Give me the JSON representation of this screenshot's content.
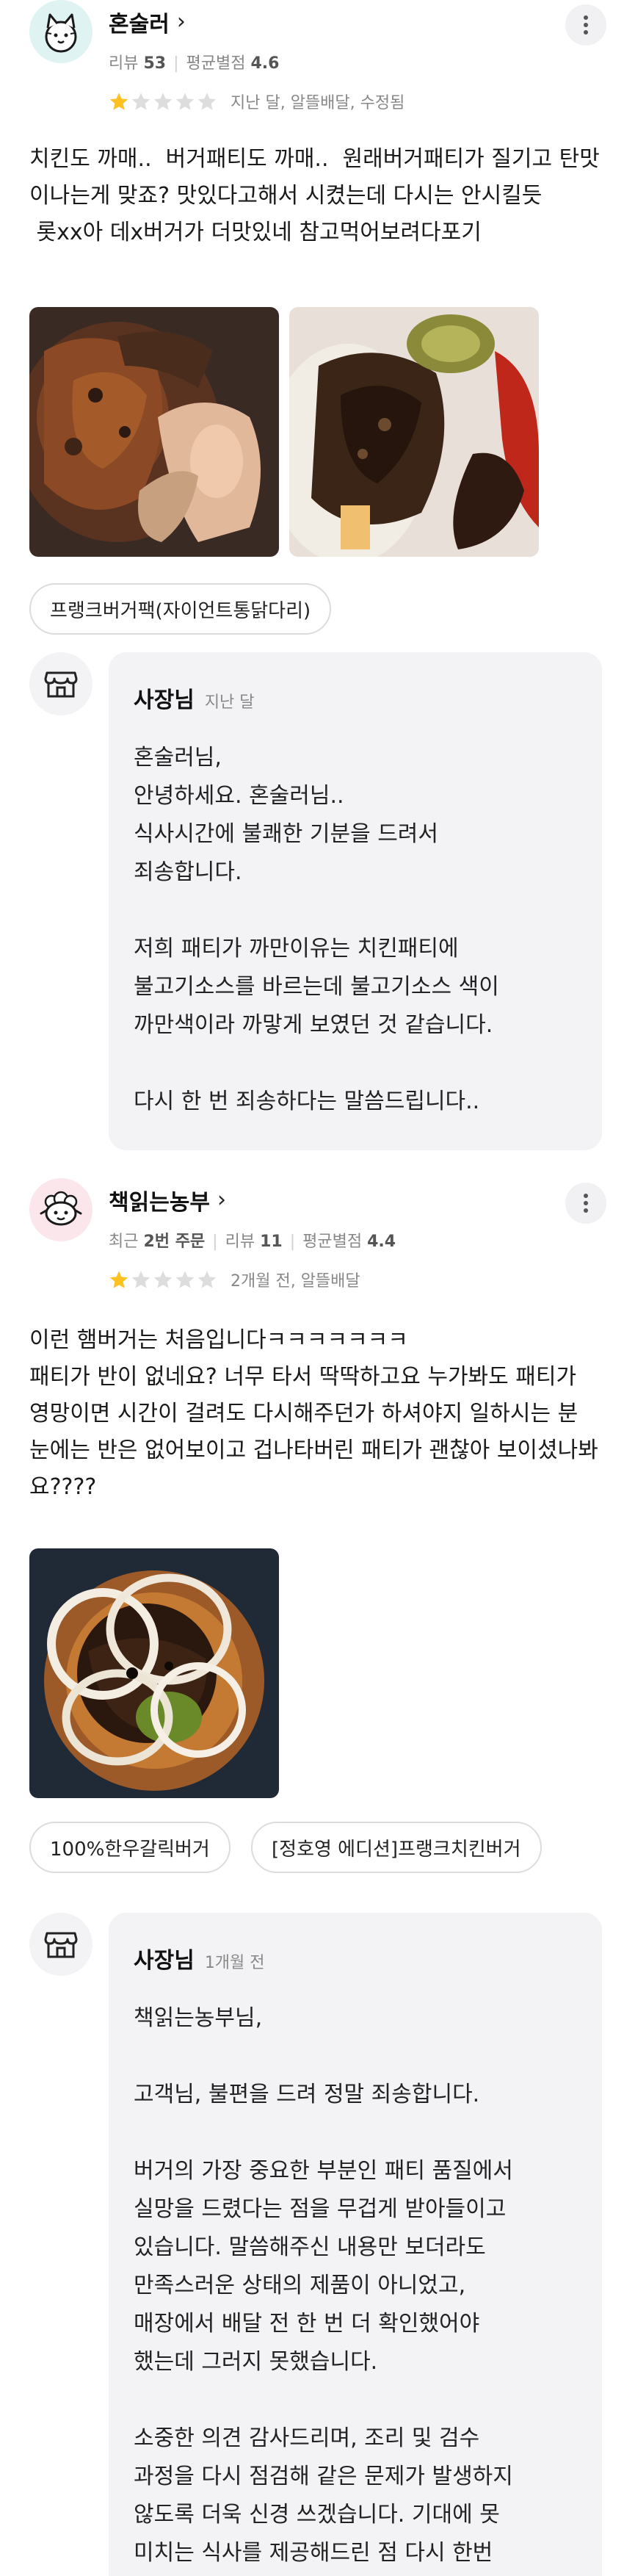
{
  "reviews": [
    {
      "nickname": "혼술러",
      "stats": {
        "review_label": "리뷰",
        "review_count": "53",
        "avg_label": "평균별점",
        "avg_value": "4.6"
      },
      "rating": 1,
      "rating_meta": "지난 달, 알뜰배달, 수정됨",
      "body": "치킨도 까매..  버거패티도 까매..  원래버거패티가 질기고 탄맛이나는게 맞죠? 맛있다고해서 시켰는데 다시는 안시킬듯\n 롯xx아 데x버거가 더맛있네 참고먹어보려다포기",
      "chips": [
        "프랭크버거팩(자이언트통닭다리)"
      ],
      "owner": {
        "name": "사장님",
        "time": "지난 달",
        "text": "혼술러님,\n안녕하세요. 혼술러님..\n식사시간에 불쾌한 기분을 드려서\n죄송합니다.\n\n저희 패티가 까만이유는 치킨패티에\n불고기소스를 바르는데 불고기소스 색이\n까만색이라 까맣게 보였던 것 같습니다.\n\n다시 한 번 죄송하다는 말씀드립니다.."
      }
    },
    {
      "nickname": "책읽는농부",
      "stats": {
        "order_label": "최근",
        "order_count": "2번 주문",
        "review_label": "리뷰",
        "review_count": "11",
        "avg_label": "평균별점",
        "avg_value": "4.4"
      },
      "rating": 1,
      "rating_meta": "2개월 전, 알뜰배달",
      "body": "이런 햄버거는 처음입니다ㅋㅋㅋㅋㅋㅋㅋ\n패티가 반이 없네요? 너무 타서 딱딱하고요 누가봐도 패티가 영망이면 시간이 걸려도 다시해주던가 하셔야지 일하시는 분 눈에는 반은 없어보이고 겁나타버린 패티가 괜찮아 보이셨나봐요????",
      "chips": [
        "100%한우갈릭버거",
        "[정호영 에디션]프랭크치킨버거"
      ],
      "owner": {
        "name": "사장님",
        "time": "1개월 전",
        "text": "책읽는농부님,\n\n고객님, 불편을 드려 정말 죄송합니다.\n\n버거의 가장 중요한 부분인 패티 품질에서\n실망을 드렸다는 점을 무겁게 받아들이고\n있습니다. 말씀해주신 내용만 보더라도\n만족스러운 상태의 제품이 아니었고,\n매장에서 배달 전 한 번 더 확인했어야\n했는데 그러지 못했습니다.\n\n소중한 의견 감사드리며, 조리 및 검수\n과정을 다시 점검해 같은 문제가 발생하지\n않도록 더욱 신경 쓰겠습니다. 기대에 못\n미치는 식사를 제공해드린 점 다시 한번\n진심으로 사과드립니다."
      }
    }
  ],
  "colors": {
    "star_on": "#ffc021",
    "star_off": "#dddddd",
    "bubble_bg": "#f3f3f5"
  },
  "icons": {
    "more": "more-vert-icon",
    "chevron": "chevron-right-icon",
    "owner": "store-icon",
    "star": "star-icon"
  }
}
